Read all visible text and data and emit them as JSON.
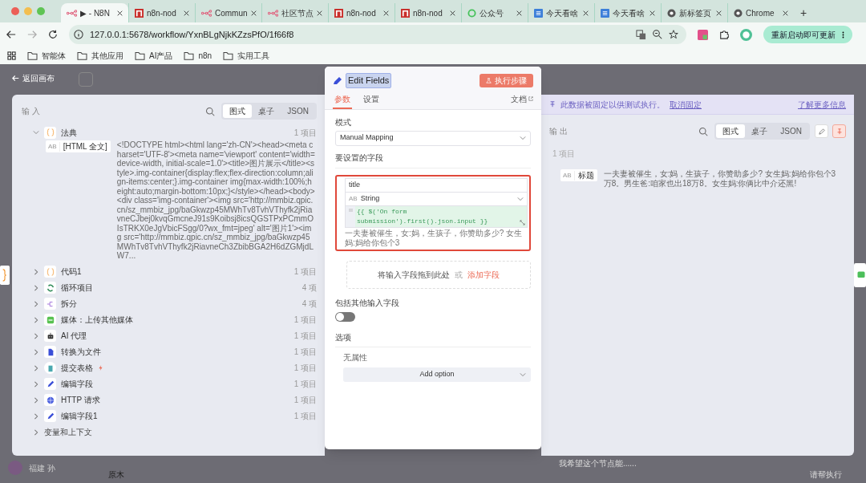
{
  "browser": {
    "tabs": [
      {
        "kind": "n8n",
        "title": "▶ - N8N",
        "selected": true
      },
      {
        "kind": "red",
        "title": "n8n-nod",
        "selected": false
      },
      {
        "kind": "n8n",
        "title": "Commun",
        "selected": false
      },
      {
        "kind": "n8n",
        "title": "社区节点",
        "selected": false
      },
      {
        "kind": "red",
        "title": "n8n-nod",
        "selected": false
      },
      {
        "kind": "red",
        "title": "n8n-nod",
        "selected": false
      },
      {
        "kind": "green",
        "title": "公众号",
        "selected": false
      },
      {
        "kind": "blue",
        "title": "今天看啥",
        "selected": false
      },
      {
        "kind": "blue",
        "title": "今天看啥",
        "selected": false
      },
      {
        "kind": "chrome",
        "title": "新标签页",
        "selected": false
      },
      {
        "kind": "chrome",
        "title": "Chrome",
        "selected": false
      }
    ],
    "new_tab": "+",
    "url": "127.0.0.1:5678/workflow/YxnBLgNjkKZzsPfO/1f66f8",
    "update_button": "重新启动即可更新",
    "bookmarks": [
      "智能体",
      "其他应用",
      "AI产品",
      "n8n",
      "实用工具"
    ]
  },
  "canvas": {
    "back_link": "返回画布",
    "user_name": "福建 孙",
    "bottom_label": "原木",
    "chat_hint": "我希望这个节点能......",
    "run_hint": "请帮执行"
  },
  "input_panel": {
    "title": "输 入",
    "view_tabs": [
      {
        "label": "图式",
        "selected": true
      },
      {
        "label": "桌子",
        "selected": false
      },
      {
        "label": "JSON",
        "selected": false
      }
    ],
    "nodes": [
      {
        "kind": "code",
        "name": "法典",
        "count": "1 项目",
        "expanded": true,
        "trigger": false,
        "fields": [
          {
            "badge": "AB",
            "key": "[HTML 全文]",
            "value": "<!DOCTYPE html><html lang='zh-CN'><head><meta charset='UTF-8'><meta name='viewport' content='width=device-width, initial-scale=1.0'><title>图片展示</title><style>.img-container{display:flex;flex-direction:column;align-items:center;}.img-container img{max-width:100%;height:auto;margin-bottom:10px;}</style></head><body><div class='img-container'><img src='http://mmbiz.qpic.cn/sz_mmbiz_jpg/baGkwzp45MWhTv8TvhVThyfk2jRiavneCJbej0kvqGmcneJ91s9Koibsj8icsQGSTPxPCmmOIsTRKX0eJgVbicFSgg/0?wx_fmt=jpeg' alt='图片1'><img src='http://mmbiz.qpic.cn/sz_mmbiz_jpg/baGkwzp45MWhTv8TvhVThyfk2jRiavneCh3ZbibBGA2H6dZGMjdLW7..."
          }
        ]
      },
      {
        "kind": "code",
        "name": "代码1",
        "count": "1 项目",
        "expanded": false,
        "trigger": false
      },
      {
        "kind": "loop",
        "name": "循环项目",
        "count": "4 项",
        "expanded": false,
        "trigger": false
      },
      {
        "kind": "split",
        "name": "拆分",
        "count": "4 项",
        "expanded": false,
        "trigger": false
      },
      {
        "kind": "media",
        "name": "媒体：上传其他媒体",
        "count": "1 项目",
        "expanded": false,
        "trigger": false
      },
      {
        "kind": "robot",
        "name": "AI 代理",
        "count": "1 项目",
        "expanded": false,
        "trigger": false
      },
      {
        "kind": "file",
        "name": "转换为文件",
        "count": "1 项目",
        "expanded": false,
        "trigger": false
      },
      {
        "kind": "form",
        "name": "提交表格",
        "count": "1 项目",
        "expanded": false,
        "trigger": true
      },
      {
        "kind": "pencil",
        "name": "编辑字段",
        "count": "1 项目",
        "expanded": false,
        "trigger": false
      },
      {
        "kind": "globe",
        "name": "HTTP 请求",
        "count": "1 项目",
        "expanded": false,
        "trigger": false
      },
      {
        "kind": "pencil",
        "name": "编辑字段1",
        "count": "1 项目",
        "expanded": false,
        "trigger": false
      }
    ],
    "variables": "变量和上下文"
  },
  "editor": {
    "title": "Edit Fields",
    "run_button": "执行步骤",
    "tabs": [
      {
        "label": "参数",
        "selected": true
      },
      {
        "label": "设置",
        "selected": false
      }
    ],
    "docs_link": "文档",
    "mode_label": "模式",
    "mode_value": "Manual Mapping",
    "fields_label": "要设置的字段",
    "assignment": {
      "name": "title",
      "type_badge": "AB",
      "type": "String",
      "value": "{{ $('On form submission').first().json.input }}",
      "preview": "一夫妻被催生，女:妈，生孩子，你赞助多少? 女生妈:妈给你包个3"
    },
    "drop_hint": "将输入字段拖到此处",
    "drop_or": "或",
    "add_field": "添加字段",
    "include_label": "包括其他输入字段",
    "include_on": false,
    "options_label": "选项",
    "no_properties": "无属性",
    "add_option": "Add option"
  },
  "output_panel": {
    "banner": "此数据被固定以供测试执行。",
    "unpin_link": "取消固定",
    "learn_more": "了解更多信息",
    "title": "输 出",
    "view_tabs": [
      {
        "label": "图式",
        "selected": true
      },
      {
        "label": "桌子",
        "selected": false
      },
      {
        "label": "JSON",
        "selected": false
      }
    ],
    "pinned": true,
    "count": "1 项目",
    "fields": [
      {
        "badge": "AB",
        "key": "标题",
        "value": "一夫妻被催生，女:妈，生孩子，你赞助多少? 女生妈:妈给你包个3万8。男生爸:咱家也出18万8。女生妈:你俩比中介还黑!"
      }
    ]
  }
}
